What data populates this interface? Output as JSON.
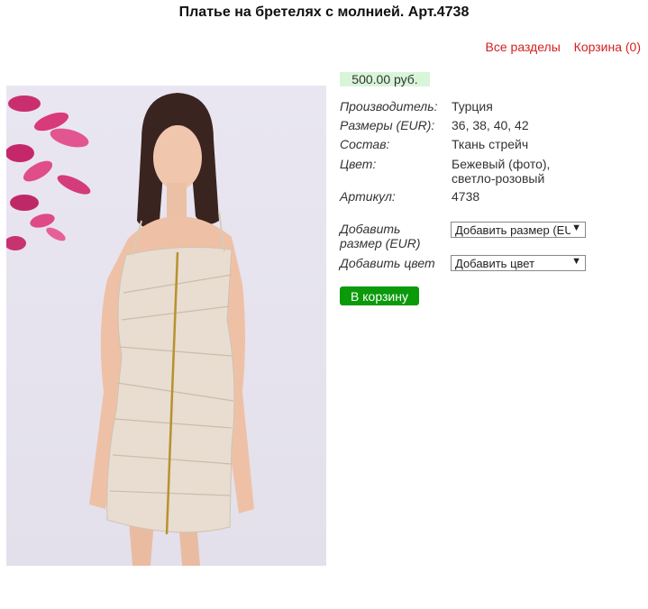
{
  "product": {
    "title": "Платье на бретелях с молнией. Арт.4738",
    "price": "500.00 руб.",
    "image_alt": "product-photo"
  },
  "nav": {
    "all_sections": "Все разделы",
    "cart": "Корзина (0)"
  },
  "props": [
    {
      "label": "Производитель:",
      "value": "Турция"
    },
    {
      "label": "Размеры (EUR):",
      "value": "36, 38, 40, 42"
    },
    {
      "label": "Состав:",
      "value": "Ткань стрейч"
    },
    {
      "label": "Цвет:",
      "value_line1": "Бежевый (фото),",
      "value_line2": "светло-розовый"
    },
    {
      "label": "Артикул:",
      "value": "4738"
    }
  ],
  "add_size": {
    "label_line1": "Добавить",
    "label_line2": "размер (EUR)",
    "selected": "Добавить размер (EUR)"
  },
  "add_color": {
    "label": "Добавить цвет",
    "selected": "Добавить цвет"
  },
  "buttons": {
    "add_to_cart": "В корзину"
  },
  "colors": {
    "link_red": "#d42020",
    "price_bg": "#d9f5d9",
    "button_green": "#0a9a0a"
  }
}
